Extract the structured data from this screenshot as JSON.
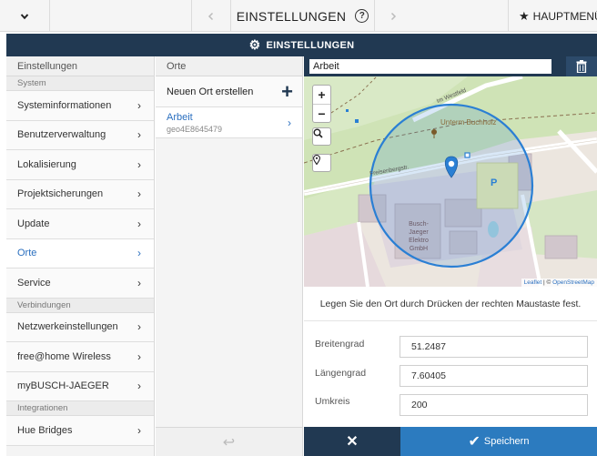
{
  "topbar": {
    "title": "EINSTELLUNGEN",
    "help_glyph": "?",
    "menu_label": "HAUPTMENÜ",
    "icons": {
      "collapse": "chevron-down-icon",
      "back": "chevron-left-icon",
      "forward": "chevron-right-icon",
      "help": "help-circle-icon",
      "menu": "star-icon"
    }
  },
  "banner": {
    "title": "EINSTELLUNGEN",
    "icon": "gear-icon"
  },
  "left": {
    "header": "Einstellungen",
    "sections": [
      {
        "label": "System",
        "items": [
          {
            "label": "Systeminformationen"
          },
          {
            "label": "Benutzerverwaltung"
          },
          {
            "label": "Lokalisierung"
          },
          {
            "label": "Projektsicherungen"
          },
          {
            "label": "Update"
          },
          {
            "label": "Orte",
            "active": true
          },
          {
            "label": "Service"
          }
        ]
      },
      {
        "label": "Verbindungen",
        "items": [
          {
            "label": "Netzwerkeinstellungen"
          },
          {
            "label": "free@home Wireless"
          },
          {
            "label": "myBUSCH-JAEGER"
          }
        ]
      },
      {
        "label": "Integrationen",
        "items": [
          {
            "label": "Hue Bridges"
          }
        ]
      }
    ]
  },
  "middle": {
    "header": "Orte",
    "new_label": "Neuen Ort erstellen",
    "places": [
      {
        "name": "Arbeit",
        "id": "geo4E8645479"
      }
    ]
  },
  "detail": {
    "name_value": "Arbeit",
    "map": {
      "zoom_in": "+",
      "zoom_out": "−",
      "labels": {
        "street_1": "Im Westfeld",
        "street_2": "Freisenbergstr.",
        "poi": "Unterm Buchholz",
        "parking": "P",
        "building_1": "Busch-",
        "building_2": "Jaeger",
        "building_3": "Elektro",
        "building_4": "GmbH"
      },
      "attribution_1": "Leaflet",
      "attribution_sep": " | © ",
      "attribution_2": "OpenStreetMap",
      "colors": {
        "circle": "#2a7fd4",
        "marker": "#2a7fd4",
        "park": "#c8dfb0",
        "land": "#ece6df"
      }
    },
    "instruction": "Legen Sie den Ort durch Drücken der rechten Maustaste fest.",
    "fields": {
      "lat_label": "Breitengrad",
      "lat_value": "51.2487",
      "lon_label": "Längengrad",
      "lon_value": "7.60405",
      "radius_label": "Umkreis",
      "radius_value": "200"
    },
    "cancel_glyph": "✕",
    "save_label": "Speichern"
  },
  "colors": {
    "navy": "#213952",
    "accent": "#2a6fbf",
    "save": "#2c7bbf"
  }
}
